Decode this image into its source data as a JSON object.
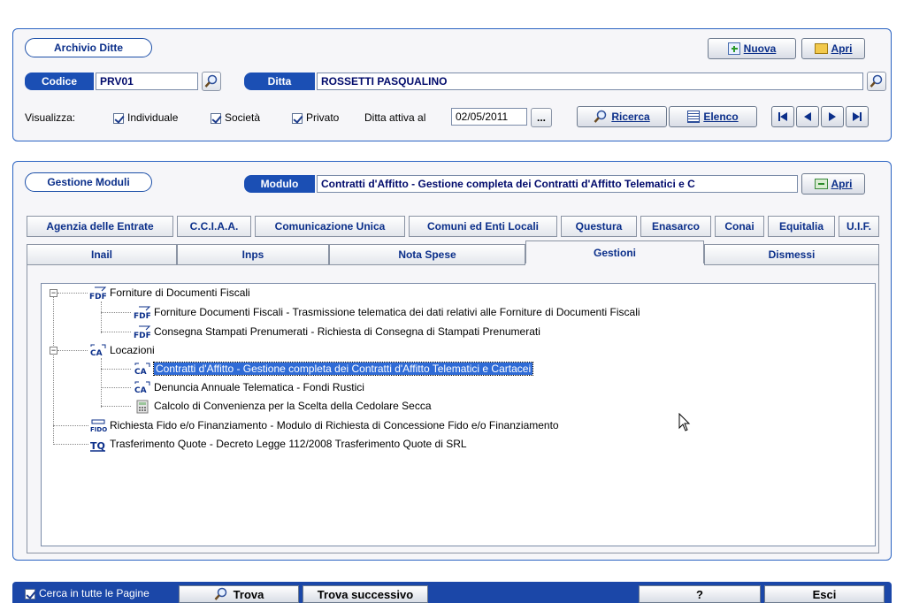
{
  "archivio": {
    "title": "Archivio Ditte",
    "nuova_label": "Nuova",
    "apri_label": "Apri",
    "codice_label": "Codice",
    "codice_value": "PRV01",
    "ditta_label": "Ditta",
    "ditta_value": "ROSSETTI PASQUALINO",
    "visualizza_label": "Visualizza:",
    "individuale_label": "Individuale",
    "societa_label": "Società",
    "privato_label": "Privato",
    "ditta_attiva_label": "Ditta attiva al",
    "ditta_attiva_value": "02/05/2011",
    "dots_label": "...",
    "ricerca_label": "Ricerca",
    "elenco_label": "Elenco"
  },
  "gestione": {
    "title": "Gestione Moduli",
    "modulo_label": "Modulo",
    "modulo_value": "Contratti d'Affitto - Gestione completa dei Contratti d'Affitto Telematici e C",
    "apri_label": "Apri"
  },
  "tabs_row1": [
    "Agenzia delle Entrate",
    "C.C.I.A.A.",
    "Comunicazione Unica",
    "Comuni ed Enti Locali",
    "Questura",
    "Enasarco",
    "Conai",
    "Equitalia",
    "U.I.F."
  ],
  "tabs_row2": [
    "Inail",
    "Inps",
    "Nota Spese",
    "Gestioni",
    "Dismessi"
  ],
  "tree": {
    "forniture": "Forniture di Documenti Fiscali",
    "forniture_docs": "Forniture Documenti Fiscali - Trasmissione telematica dei dati relativi alle Forniture di Documenti Fiscali",
    "consegna": "Consegna Stampati Prenumerati - Richiesta di Consegna di Stampati Prenumerati",
    "locazioni": "Locazioni",
    "contratti": "Contratti d'Affitto - Gestione completa dei Contratti d'Affitto Telematici e Cartacei",
    "denuncia": "Denuncia Annuale Telematica - Fondi Rustici",
    "calcolo": "Calcolo di Convenienza per la Scelta della Cedolare Secca",
    "richiesta": "Richiesta Fido e/o Finanziamento - Modulo di Richiesta di Concessione Fido e/o Finanziamento",
    "trasferimento": "Trasferimento Quote - Decreto Legge 112/2008 Trasferimento Quote di SRL",
    "icon_fdf": "FDF",
    "icon_ca": "CA",
    "icon_fido": "FIDO",
    "icon_tq": "TQ"
  },
  "footer": {
    "cerca_label": "Cerca in tutte le Pagine",
    "trova_label": "Trova",
    "trova_succ_label": "Trova successivo",
    "help_label": "?",
    "esci_label": "Esci"
  }
}
